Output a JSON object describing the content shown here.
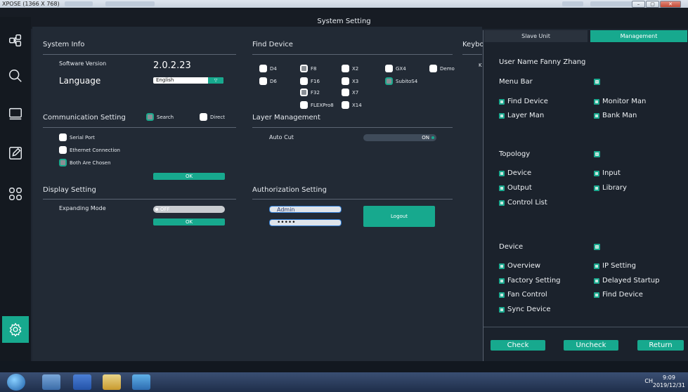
{
  "window": {
    "title": "XPOSE (1366 X 768)"
  },
  "app": {
    "title": "System Setting"
  },
  "sidebar": {
    "icons": [
      "layout-icon",
      "search-icon",
      "monitor-icon",
      "edit-icon",
      "grid-icon",
      "settings-icon"
    ]
  },
  "system_info": {
    "heading": "System Info",
    "software_version_label": "Software Version",
    "software_version_value": "2.0.2.23",
    "language_label": "Language",
    "language_value": "English"
  },
  "find_device": {
    "heading": "Find Device",
    "devices": [
      {
        "label": "D4",
        "checked": false
      },
      {
        "label": "F8",
        "checked": true
      },
      {
        "label": "X2",
        "checked": false
      },
      {
        "label": "GX4",
        "checked": false
      },
      {
        "label": "Demo",
        "checked": false
      },
      {
        "label": "D6",
        "checked": false
      },
      {
        "label": "F16",
        "checked": false
      },
      {
        "label": "X3",
        "checked": false
      },
      {
        "label": "SubitoS4",
        "checked": true
      },
      {
        "label": "F32",
        "checked": true
      },
      {
        "label": "X7",
        "checked": false
      },
      {
        "label": "FLEXPro8",
        "checked": false
      },
      {
        "label": "X14",
        "checked": false
      }
    ]
  },
  "keyboard": {
    "heading": "Keybo",
    "sub": "K"
  },
  "communication": {
    "heading": "Communication Setting",
    "search_label": "Search",
    "direct_label": "Direct",
    "serial_port": "Serial Port",
    "ethernet": "Ethernet Connection",
    "both": "Both Are Chosen",
    "ok": "OK"
  },
  "layer": {
    "heading": "Layer Management",
    "auto_cut_label": "Auto Cut",
    "auto_cut_value": "ON"
  },
  "display": {
    "heading": "Display Setting",
    "expanding_label": "Expanding Mode",
    "expanding_value": "OFF",
    "ok": "OK"
  },
  "authorization": {
    "heading": "Authorization Setting",
    "username": "Admin",
    "password": "•••••",
    "logout": "Logout"
  },
  "panel": {
    "tab_slave": "Slave Unit",
    "tab_management": "Management",
    "user_name": "User Name  Fanny Zhang",
    "menu_bar": "Menu Bar",
    "menu_items": [
      "Find Device",
      "Monitor Man",
      "Layer Man",
      "Bank Man"
    ],
    "topology": "Topology",
    "topology_items": [
      "Device",
      "Input",
      "Output",
      "Library",
      "Control List"
    ],
    "device": "Device",
    "device_items": [
      "Overview",
      "IP Setting",
      "Factory Setting",
      "Delayed Startup",
      "Fan Control",
      "Find Device",
      "Sync Device"
    ],
    "check": "Check",
    "uncheck": "Uncheck",
    "return": "Return"
  },
  "taskbar": {
    "tray_text": "CH",
    "time": "9:09",
    "date": "2019/12/31"
  }
}
